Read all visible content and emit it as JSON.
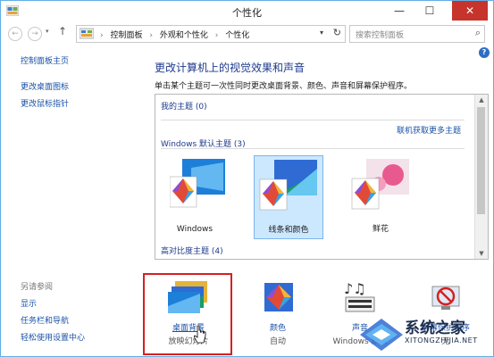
{
  "window": {
    "title": "个性化",
    "minimize": "—",
    "maximize": "☐",
    "close": "✕"
  },
  "nav": {
    "back": "←",
    "forward": "→",
    "up": "↑",
    "breadcrumbs": [
      "控制面板",
      "外观和个性化",
      "个性化"
    ],
    "separator": "›",
    "search_placeholder": "搜索控制面板"
  },
  "sidebar": {
    "items": [
      {
        "label": "控制面板主页"
      },
      {
        "label": "更改桌面图标"
      },
      {
        "label": "更改鼠标指针"
      }
    ],
    "see_also_header": "另请参阅",
    "see_also": [
      {
        "label": "显示"
      },
      {
        "label": "任务栏和导航"
      },
      {
        "label": "轻松使用设置中心"
      }
    ]
  },
  "main": {
    "heading": "更改计算机上的视觉效果和声音",
    "subtitle": "单击某个主题可一次性同时更改桌面背景、颜色、声音和屏幕保护程序。",
    "my_themes": "我的主题 (0)",
    "online_link": "联机获取更多主题",
    "default_themes": "Windows 默认主题 (3)",
    "high_contrast": "高对比度主题 (4)",
    "themes": [
      {
        "label": "Windows",
        "selected": false
      },
      {
        "label": "线条和颜色",
        "selected": true
      },
      {
        "label": "鲜花",
        "selected": false
      }
    ]
  },
  "bottom": [
    {
      "label": "桌面背景",
      "sub": "放映幻灯片"
    },
    {
      "label": "颜色",
      "sub": "自动"
    },
    {
      "label": "声音",
      "sub": "Windows 默认"
    },
    {
      "label": "屏幕保护程序",
      "sub": "无"
    }
  ],
  "watermark": {
    "text": "系统之家",
    "url": "XITONGZHIJIA.NET"
  },
  "colors": {
    "accent": "#1e3a8c",
    "link": "#1a52a7",
    "highlight": "#d62020"
  }
}
